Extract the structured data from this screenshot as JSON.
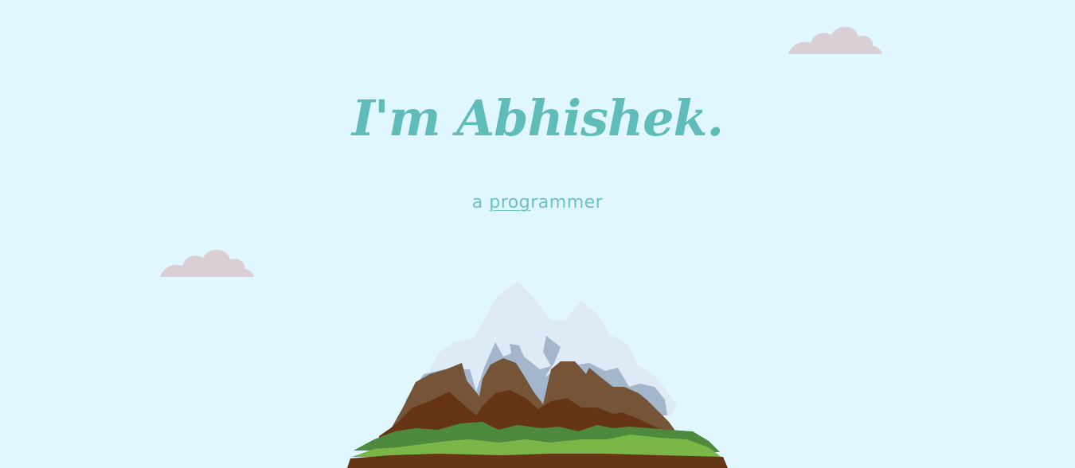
{
  "hero": {
    "title": "I'm Abhishek.",
    "subtitle_prefix": "a ",
    "subtitle_typed": "prog",
    "subtitle_rest": "rammer"
  },
  "decor": {
    "clouds": [
      "cloud-icon",
      "cloud-icon"
    ],
    "illustration": "mountain-illustration"
  },
  "colors": {
    "background": "#e0f7ff",
    "accent": "#5fbcb8",
    "cloud": "#dbcfd6",
    "snow": "#dfeaf7",
    "rock_shadow": "#a3b6cc",
    "rock_light": "#765437",
    "rock_dark": "#663515",
    "grass_dark": "#4e8a3e",
    "grass_light": "#7ab648"
  }
}
